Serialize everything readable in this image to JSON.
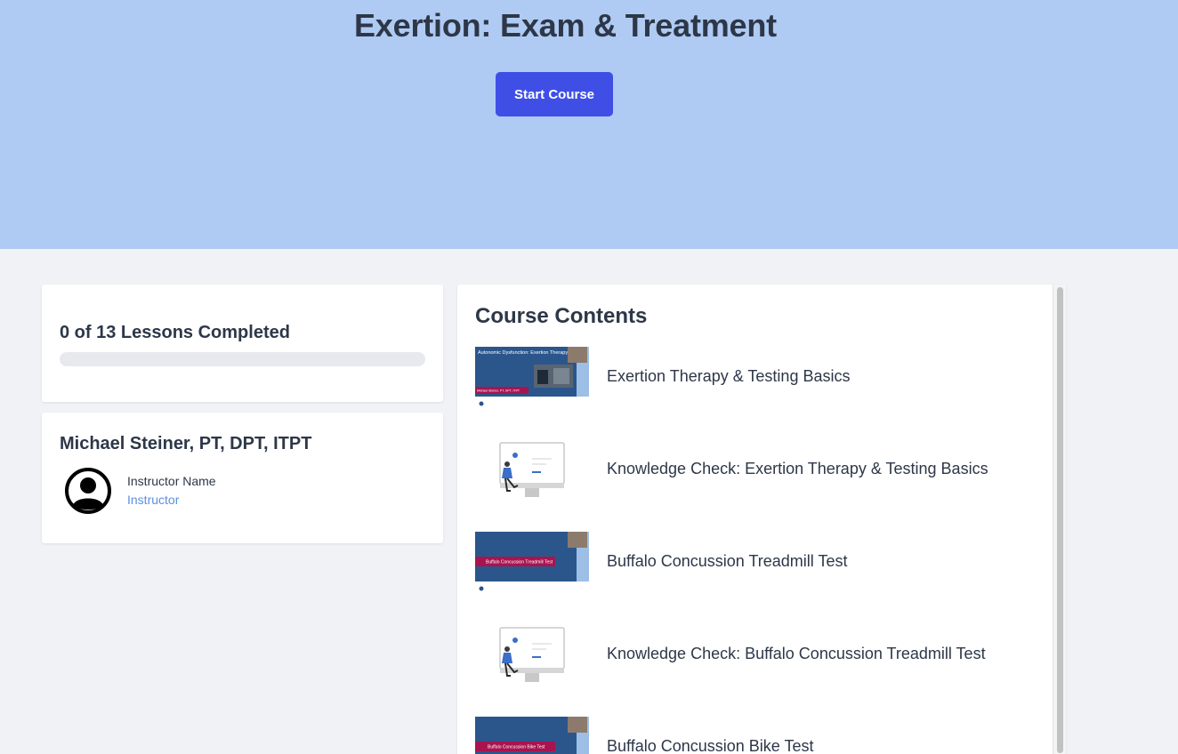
{
  "hero": {
    "title": "Exertion: Exam & Treatment",
    "start_button": "Start Course",
    "background": "#afcbf3",
    "button_color": "#3f4fe6"
  },
  "progress": {
    "label": "0 of 13 Lessons Completed",
    "completed": 0,
    "total": 13,
    "fraction": 0
  },
  "instructor": {
    "heading": "Michael Steiner, PT, DPT, ITPT",
    "name_label": "Instructor Name",
    "role": "Instructor",
    "avatar_icon": "user-circle-icon"
  },
  "contents": {
    "heading": "Course Contents",
    "lessons": [
      {
        "title": "Exertion Therapy & Testing Basics",
        "thumb": "slide",
        "slide_title": "Autonomic Dysfunction: Exertion Therapy",
        "slide_footer": "Michael Steiner, PT, DPT, ITPT"
      },
      {
        "title": "Knowledge Check: Exertion Therapy & Testing Basics",
        "thumb": "quiz"
      },
      {
        "title": "Buffalo Concussion Treadmill Test",
        "thumb": "banner",
        "banner_text": "Buffalo Concussion Treadmill Test"
      },
      {
        "title": "Knowledge Check: Buffalo Concussion Treadmill Test",
        "thumb": "quiz"
      },
      {
        "title": "Buffalo Concussion Bike Test",
        "thumb": "banner",
        "banner_text": "Buffalo Concussion Bike Test"
      }
    ]
  }
}
